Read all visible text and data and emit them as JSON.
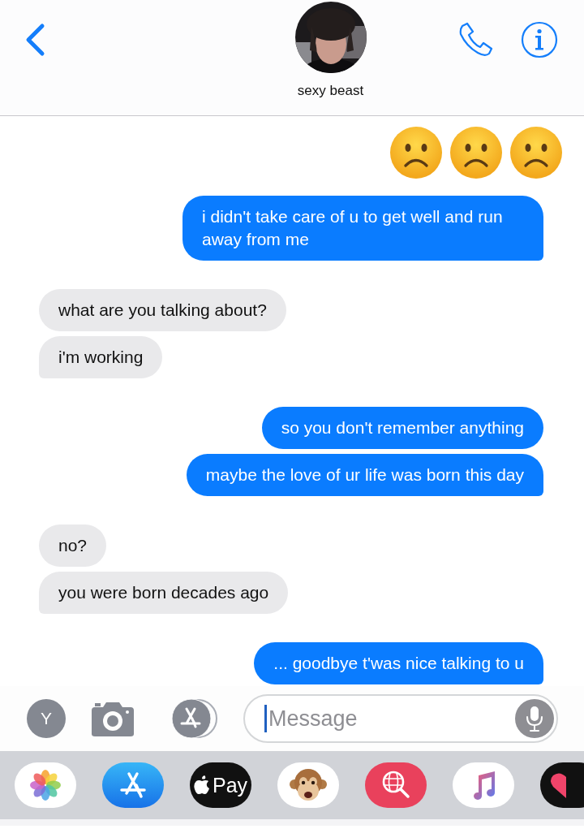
{
  "header": {
    "contact_name": "sexy beast"
  },
  "messages": [
    {
      "kind": "sent_emoji",
      "faces": [
        {
          "kind": "frowning"
        },
        {
          "kind": "frowning"
        },
        {
          "kind": "frowning"
        }
      ]
    },
    {
      "kind": "sent",
      "text": "i didn't take care of u to get well and run away from me",
      "tail": true
    },
    {
      "kind": "received",
      "text": "what are you talking about?",
      "tail": false
    },
    {
      "kind": "received",
      "text": "i'm working",
      "tail": true
    },
    {
      "kind": "sent",
      "text": "so you don't remember anything",
      "tail": false
    },
    {
      "kind": "sent",
      "text": "maybe the love of ur life was born this day",
      "tail": true
    },
    {
      "kind": "received",
      "text": "no?",
      "tail": false
    },
    {
      "kind": "received",
      "text": "you were born decades ago",
      "tail": true
    },
    {
      "kind": "sent",
      "text": "... goodbye t'was nice talking to u",
      "tail": true
    }
  ],
  "input_bar": {
    "avatar_letter": "Y",
    "placeholder": "Message",
    "focused": true
  },
  "app_drawer": [
    {
      "kind": "photos"
    },
    {
      "kind": "store"
    },
    {
      "kind": "pay",
      "label": "Pay"
    },
    {
      "kind": "monkey"
    },
    {
      "kind": "search"
    },
    {
      "kind": "music"
    },
    {
      "kind": "heart"
    }
  ]
}
